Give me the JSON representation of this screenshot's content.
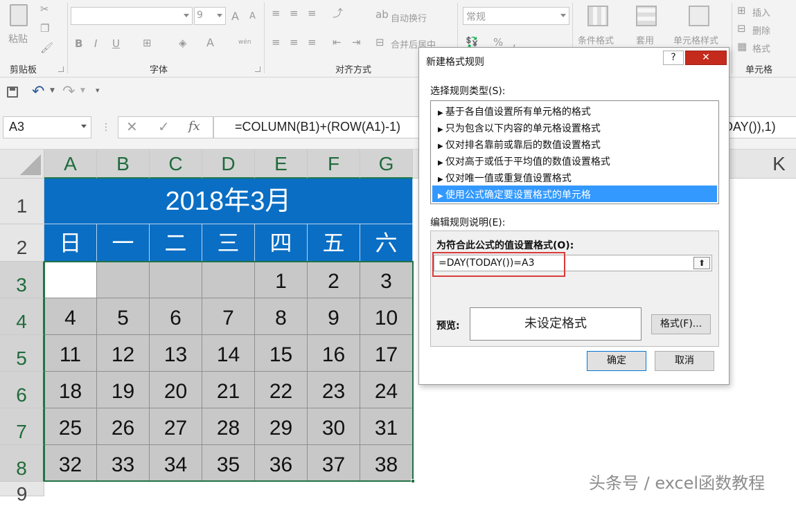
{
  "ribbon": {
    "clipboard": {
      "paste": "粘贴",
      "group": "剪贴板"
    },
    "font": {
      "size": "9",
      "bold": "B",
      "italic": "I",
      "underline": "U",
      "font_color": "A",
      "grow": "A",
      "shrink": "A",
      "phonetic": "wén",
      "group": "字体"
    },
    "alignment": {
      "wrap": "自动换行",
      "merge": "合并后居中",
      "group": "对齐方式"
    },
    "number": {
      "format": "常规"
    },
    "styles": {
      "conditional": "条件格式",
      "table": "套用",
      "cell_styles": "单元格样式"
    },
    "cells": {
      "insert": "插入",
      "delete": "删除",
      "format": "格式",
      "group": "单元格"
    }
  },
  "formula_bar": {
    "name_box": "A3",
    "fx": "fx",
    "formula_left": "=COLUMN(B1)+(ROW(A1)-1)",
    "formula_right": "DAY()),1)"
  },
  "sheet": {
    "columns": [
      "A",
      "B",
      "C",
      "D",
      "E",
      "F",
      "G"
    ],
    "extra_column": "K",
    "rows": [
      "1",
      "2",
      "3",
      "4",
      "5",
      "6",
      "7",
      "8",
      "9"
    ],
    "title": "2018年3月",
    "weekdays": [
      "日",
      "一",
      "二",
      "三",
      "四",
      "五",
      "六"
    ],
    "calendar": [
      [
        "",
        "",
        "",
        "",
        "1",
        "2",
        "3"
      ],
      [
        "4",
        "5",
        "6",
        "7",
        "8",
        "9",
        "10"
      ],
      [
        "11",
        "12",
        "13",
        "14",
        "15",
        "16",
        "17"
      ],
      [
        "18",
        "19",
        "20",
        "21",
        "22",
        "23",
        "24"
      ],
      [
        "25",
        "26",
        "27",
        "28",
        "29",
        "30",
        "31"
      ],
      [
        "32",
        "33",
        "34",
        "35",
        "36",
        "37",
        "38"
      ]
    ],
    "colors": {
      "header_blue": "#0a6ec4",
      "cell_gray": "#c8c8c8",
      "active_white": "#ffffff"
    }
  },
  "dialog": {
    "title": "新建格式规则",
    "help": "?",
    "close": "✕",
    "rule_type_label": "选择规则类型(S):",
    "rule_types": [
      "基于各自值设置所有单元格的格式",
      "只为包含以下内容的单元格设置格式",
      "仅对排名靠前或靠后的数值设置格式",
      "仅对高于或低于平均值的数值设置格式",
      "仅对唯一值或重复值设置格式",
      "使用公式确定要设置格式的单元格"
    ],
    "selected_rule_index": 5,
    "edit_label": "编辑规则说明(E):",
    "formula_label": "为符合此公式的值设置格式(O):",
    "formula_value": "=DAY(TODAY())=A3",
    "preview_label": "预览:",
    "preview_text": "未设定格式",
    "format_button": "格式(F)...",
    "ok_button": "确定",
    "cancel_button": "取消"
  },
  "watermark": "头条号 / excel函数教程"
}
